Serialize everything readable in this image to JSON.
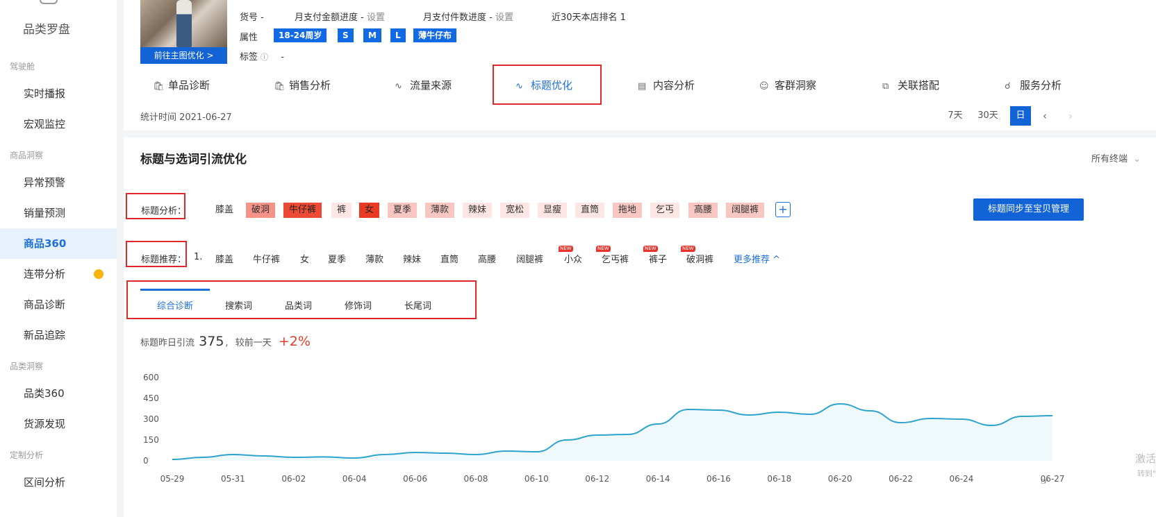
{
  "sidebar": {
    "app_title": "品类罗盘",
    "groups": [
      {
        "label": "驾驶舱",
        "items": [
          "实时播报",
          "宏观监控"
        ]
      },
      {
        "label": "商品洞察",
        "items": [
          "异常预警",
          "销量预测",
          "商品360",
          "连带分析",
          "商品诊断",
          "新品追踪"
        ]
      },
      {
        "label": "品类洞察",
        "items": [
          "品类360",
          "货源发现"
        ]
      },
      {
        "label": "定制分析",
        "items": [
          "区间分析"
        ]
      }
    ],
    "active_item": "商品360"
  },
  "product": {
    "thumb_button": "前往主图优化 >",
    "sku_label": "货号 -",
    "monthly_amount_label": "月支付金额进度 -",
    "monthly_amount_link": "设置",
    "monthly_count_label": "月支付件数进度 -",
    "monthly_count_link": "设置",
    "rank_text": "近30天本店排名 1",
    "attr_label": "属性",
    "attr_tags": [
      "18-24周岁",
      "S",
      "M",
      "L",
      "薄牛仔布"
    ],
    "tag_label": "标签",
    "tag_value": "-"
  },
  "tabs": [
    {
      "label": "单品诊断",
      "icon": "bag-icon"
    },
    {
      "label": "销售分析",
      "icon": "bag-icon"
    },
    {
      "label": "流量来源",
      "icon": "line-chart-icon"
    },
    {
      "label": "标题优化",
      "icon": "line-chart-icon",
      "active": true
    },
    {
      "label": "内容分析",
      "icon": "document-icon"
    },
    {
      "label": "客群洞察",
      "icon": "users-icon"
    },
    {
      "label": "关联搭配",
      "icon": "link-icon"
    },
    {
      "label": "服务分析",
      "icon": "headset-icon"
    }
  ],
  "stat_time": "统计时间 2021-06-27",
  "periods": [
    "7天",
    "30天",
    "日"
  ],
  "active_period": "日",
  "section": {
    "title": "标题与选词引流优化",
    "terminal_filter": "所有终端",
    "analysis_label": "标题分析：",
    "analysis_keywords": [
      {
        "text": "膝盖",
        "level": 0
      },
      {
        "text": "破洞",
        "level": 3
      },
      {
        "text": "牛仔裤",
        "level": 4
      },
      {
        "text": "裤",
        "level": 1
      },
      {
        "text": "女",
        "level": 5
      },
      {
        "text": "夏季",
        "level": 2
      },
      {
        "text": "薄款",
        "level": 2
      },
      {
        "text": "辣妹",
        "level": 1
      },
      {
        "text": "宽松",
        "level": 1
      },
      {
        "text": "显瘦",
        "level": 1
      },
      {
        "text": "直筒",
        "level": 1
      },
      {
        "text": "拖地",
        "level": 2
      },
      {
        "text": "乞丐",
        "level": 1
      },
      {
        "text": "高腰",
        "level": 2
      },
      {
        "text": "阔腿裤",
        "level": 2
      }
    ],
    "sync_button": "标题同步至宝贝管理",
    "recommend_label": "标题推荐：",
    "recommend_index": "1.",
    "recommend_keywords": [
      {
        "text": "膝盖"
      },
      {
        "text": "牛仔裤"
      },
      {
        "text": "女"
      },
      {
        "text": "夏季"
      },
      {
        "text": "薄款"
      },
      {
        "text": "辣妹"
      },
      {
        "text": "直筒"
      },
      {
        "text": "高腰"
      },
      {
        "text": "阔腿裤"
      },
      {
        "text": "小众",
        "badge": "NEW"
      },
      {
        "text": "乞丐裤",
        "badge": "NEW"
      },
      {
        "text": "裤子",
        "badge": "NEW"
      },
      {
        "text": "破洞裤",
        "badge": "NEW"
      }
    ],
    "more_recommend": "更多推荐 ^",
    "subtabs": [
      "综合诊断",
      "搜索词",
      "品类词",
      "修饰词",
      "长尾词"
    ],
    "active_subtab": "综合诊断",
    "kpi_label": "标题昨日引流",
    "kpi_value": "375",
    "kpi_compare_label": "较前一天",
    "kpi_delta": "+2%"
  },
  "watermark": {
    "line1": "激活",
    "line2": "转到\""
  },
  "chart_data": {
    "type": "area",
    "x": [
      "05-29",
      "05-30",
      "05-31",
      "06-01",
      "06-02",
      "06-03",
      "06-04",
      "06-05",
      "06-06",
      "06-07",
      "06-08",
      "06-09",
      "06-10",
      "06-11",
      "06-12",
      "06-13",
      "06-14",
      "06-15",
      "06-16",
      "06-17",
      "06-18",
      "06-19",
      "06-20",
      "06-21",
      "06-22",
      "06-23",
      "06-24",
      "06-25",
      "06-26",
      "06-27"
    ],
    "x_tick_labels": [
      "05-29",
      "05-31",
      "06-02",
      "06-04",
      "06-06",
      "06-08",
      "06-10",
      "06-12",
      "06-14",
      "06-16",
      "06-18",
      "06-20",
      "06-22",
      "06-24",
      "06-27"
    ],
    "series": [
      {
        "values": [
          10,
          25,
          45,
          35,
          25,
          28,
          20,
          45,
          60,
          55,
          45,
          70,
          65,
          150,
          185,
          190,
          265,
          370,
          365,
          330,
          350,
          335,
          410,
          360,
          275,
          305,
          300,
          255,
          320,
          325
        ]
      }
    ],
    "yticks": [
      0,
      150,
      300,
      450,
      600
    ],
    "ylim": [
      0,
      600
    ],
    "color": "#2ea3cc"
  }
}
